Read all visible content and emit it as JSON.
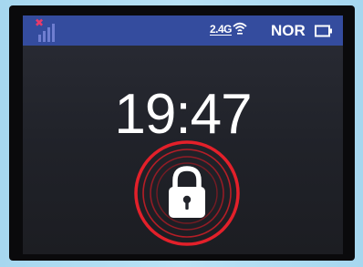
{
  "status_bar": {
    "signal_icon": "signal-no-service-icon",
    "wifi_band": "2.4G",
    "wifi_icon": "wifi-icon",
    "mode": "NOR",
    "battery_icon": "battery-icon"
  },
  "clock": {
    "time": "19:47"
  },
  "lock": {
    "icon": "padlock-icon",
    "ring_color": "#e3202a"
  },
  "colors": {
    "status_bar": "#344c9e",
    "screen_bg": "#23252c",
    "accent_red": "#e3202a"
  }
}
